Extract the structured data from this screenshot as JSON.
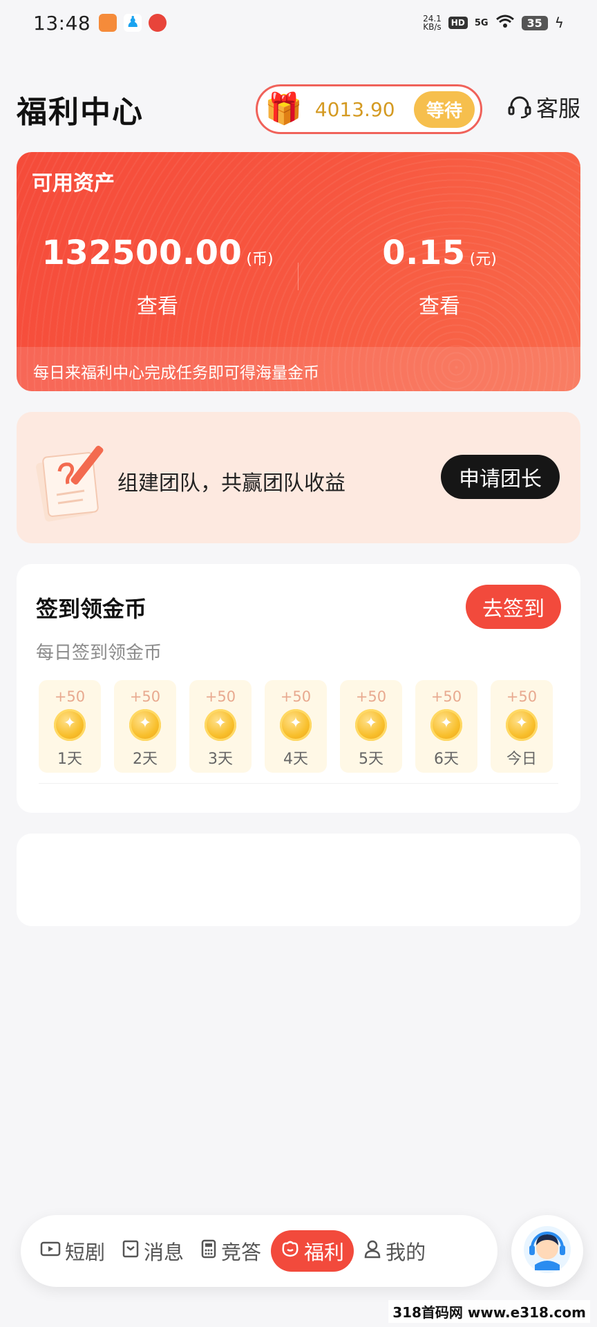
{
  "status_bar": {
    "time": "13:48",
    "net_speed_value": "24.1",
    "net_speed_unit": "KB/s",
    "hd": "HD",
    "signal": "5G",
    "battery": "35"
  },
  "header": {
    "title": "福利中心",
    "reward_amount": "4013.90",
    "wait_label": "等待",
    "service_label": "客服"
  },
  "assets": {
    "title": "可用资产",
    "coins_value": "132500.00",
    "coins_unit": "(币)",
    "cash_value": "0.15",
    "cash_unit": "(元)",
    "view_label_left": "查看",
    "view_label_right": "查看",
    "footer": "每日来福利中心完成任务即可得海量金币"
  },
  "team": {
    "text": "组建团队，共赢团队收益",
    "apply_label": "申请团长"
  },
  "signin": {
    "title": "签到领金币",
    "button": "去签到",
    "subtitle": "每日签到领金币",
    "days": [
      {
        "reward": "+50",
        "label": "1天"
      },
      {
        "reward": "+50",
        "label": "2天"
      },
      {
        "reward": "+50",
        "label": "3天"
      },
      {
        "reward": "+50",
        "label": "4天"
      },
      {
        "reward": "+50",
        "label": "5天"
      },
      {
        "reward": "+50",
        "label": "6天"
      },
      {
        "reward": "+50",
        "label": "今日"
      }
    ]
  },
  "nav": {
    "items": [
      {
        "label": "短剧",
        "icon": "video-icon"
      },
      {
        "label": "消息",
        "icon": "message-icon"
      },
      {
        "label": "竞答",
        "icon": "calculator-icon"
      },
      {
        "label": "福利",
        "icon": "gift-bag-icon"
      },
      {
        "label": "我的",
        "icon": "user-icon"
      }
    ],
    "active": "福利"
  },
  "watermark": "318首码网 www.e318.com",
  "colors": {
    "accent": "#f24a3c",
    "reward_gold": "#d49a22",
    "wait_button": "#f6bf4d",
    "banner_bg": "#fde9e0"
  }
}
